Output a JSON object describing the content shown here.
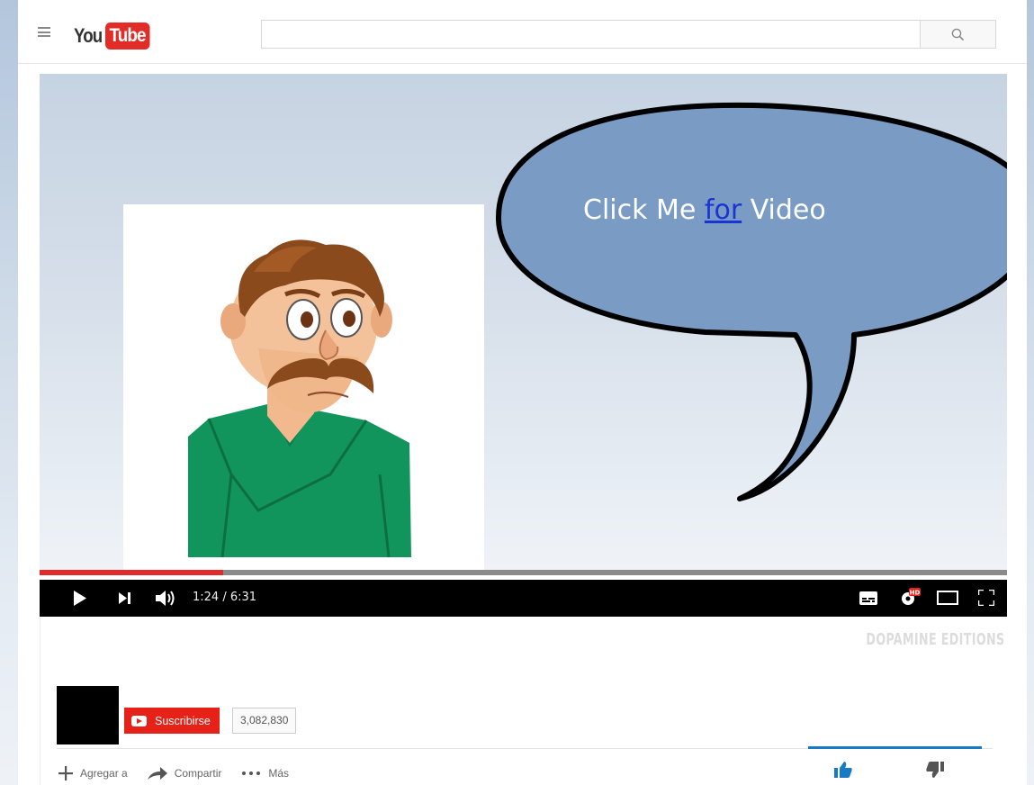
{
  "header": {
    "logo_you": "You",
    "logo_tube": "Tube",
    "search_placeholder": ""
  },
  "video": {
    "bubble_word1": "Click Me ",
    "bubble_link": "for",
    "bubble_word2": " Video",
    "progress_fraction": 0.19,
    "time_display": "1:24 / 6:31"
  },
  "channel": {
    "watermark": "DOPAMINE EDITIONS",
    "subscribe_label": "Suscribirse",
    "subscriber_count": "3,082,830"
  },
  "actions": {
    "add_label": "Agregar a",
    "share_label": "Compartir",
    "more_label": "Más"
  },
  "colors": {
    "accent_red": "#e62117",
    "progress_red": "#e32a2a",
    "bubble_fill": "#7a9bc4",
    "like_blue": "#167ac6"
  }
}
